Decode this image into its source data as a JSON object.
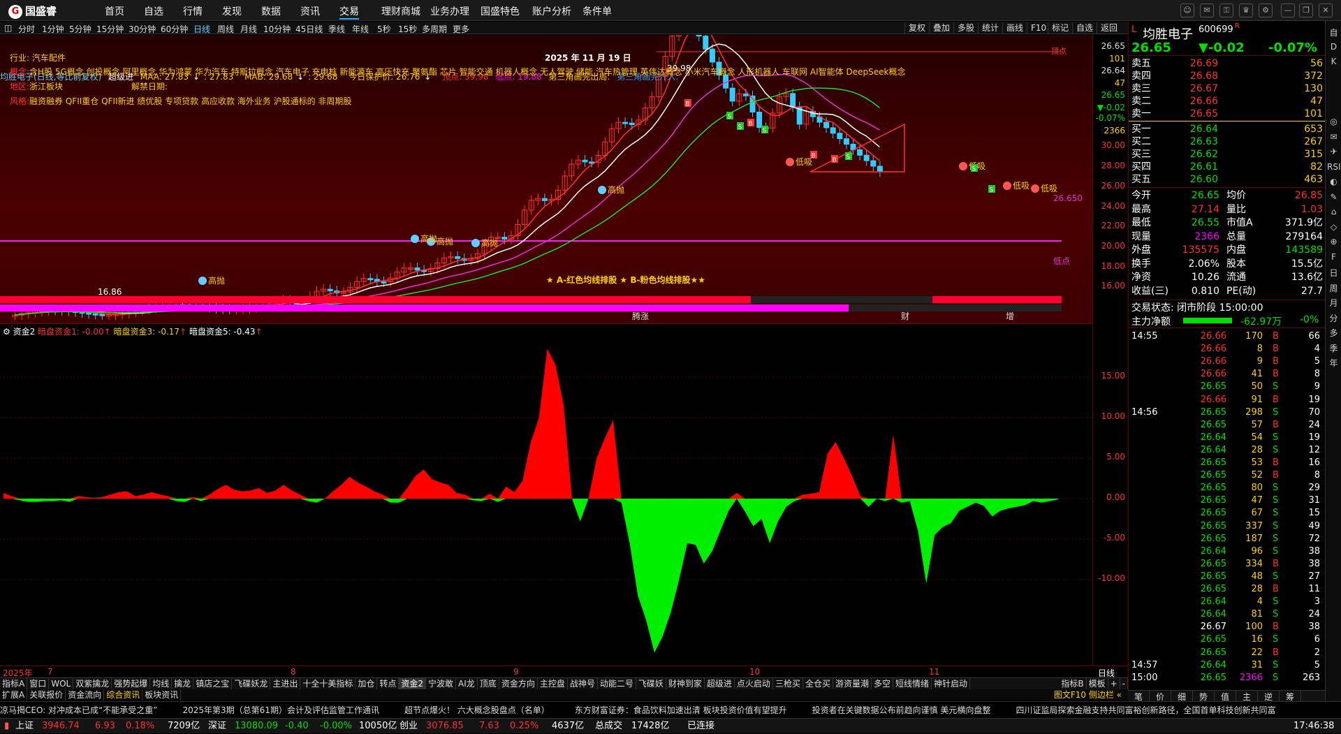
{
  "app": {
    "name": "国盛睿",
    "logo_glyph": "G"
  },
  "nav": [
    "首页",
    "自选",
    "行情",
    "发现",
    "数据",
    "资讯",
    "交易",
    "理财商城",
    "业务办理",
    "国盛特色",
    "账户分析",
    "条件单"
  ],
  "nav_active": 6,
  "period_bar": {
    "items": [
      "分时",
      "1分钟",
      "5分钟",
      "15分钟",
      "30分钟",
      "60分钟",
      "日线",
      "周线",
      "月线",
      "10分钟",
      "45日线",
      "季线",
      "年线",
      "5秒",
      "15秒",
      "多周期",
      "更多"
    ],
    "active": 6,
    "right": [
      "复权",
      "叠加",
      "多股",
      "统计",
      "画线",
      "F10",
      "标记",
      "自选",
      "返回"
    ]
  },
  "info": {
    "stock": "均胜电子(日线,等比前复权)",
    "indicator": "超级进",
    "maa": "MAA: 27.83",
    "maa_arrow": "↓",
    "maa2": ": 27.83",
    "mab": "MAB: 29.68",
    "mab_arrow": "↓",
    "mab2": ": 29.68",
    "guard": "今日保护价: 26.76",
    "guard_arrow": "↓",
    "top": "顶点: 39.98",
    "bottom": "低点: 19.88",
    "tri1": "第三角画完出局:",
    "tri2": "第三角画完介入:"
  },
  "overlay": {
    "industry": "行业: 汽车配件",
    "date": "2025 年 11 月 19 日",
    "concept_label": "概念:",
    "concepts": "含H股 5G概念 创投概念 阿里概念 华为鸿蒙 华为汽车 特斯拉概念 汽车电子 充电桩 新能源车 高压快充 聚氨酯 芯片 智能交通 机器人概念 无人驾驶 储能 汽车热管理 英伟达概念 小米汽车概念 人形机器人 车联网 AI智能体 DeepSeek概念",
    "region_label": "地区:",
    "region": "浙江板块",
    "ban_label": "解禁日期:",
    "style_label": "风格:",
    "style": "融资融券 QFII重仓 QFII新进 绩优股 专项贷款 高应收款 海外业务 沪股通标的 非周期股",
    "legend": "★ A-红色均线排股 ★ B-粉色均线排股★★",
    "peak": "39.98",
    "low_label": "低点",
    "low_val": "16.86",
    "last_val": "26.650",
    "tags": [
      "高抛",
      "高抛",
      "高抛",
      "高抛",
      "高抛",
      "低吸",
      "低吸",
      "低吸",
      "低吸",
      "低吸"
    ],
    "top_label": "顶点",
    "strip_labels": [
      "腾涨",
      "财",
      "增"
    ]
  },
  "k_axis": [
    "26.65",
    "101",
    "26.64",
    "47",
    "26.65",
    "▼-0.02",
    "-0.07%",
    "2366",
    "30.00",
    "28.00",
    "26.00",
    "24.00",
    "22.00",
    "20.00",
    "18.00",
    "16.00"
  ],
  "lower": {
    "title": "资金2",
    "s1": "暗盘资金1: -0.00",
    "s1a": "↑",
    "s3": "暗盘资金3: -0.17",
    "s3a": "↑",
    "s5": "暗盘资金5: -0.43",
    "s5a": "↑",
    "axis": [
      "15.00",
      "10.00",
      "5.00",
      "0.00",
      "-5.00",
      "-10.00"
    ]
  },
  "chart_data": {
    "type": "area",
    "title": "资金2",
    "ylim": [
      -19,
      19
    ],
    "series": [
      {
        "name": "暗盘资金",
        "values": [
          0.7,
          0.3,
          -0.2,
          -0.4,
          -0.4,
          -0.3,
          -0.3,
          -0.2,
          -0.4,
          0.3,
          0.2,
          0.1,
          0.2,
          0.5,
          0.8,
          0.9,
          0.3,
          0.5,
          0.8,
          0.5,
          0.3,
          -0.3,
          -0.4,
          0.2,
          -0.3,
          0.5,
          1.2,
          1.7,
          1.1,
          0.9,
          1.0,
          1.3,
          0.7,
          1.0,
          1.7,
          1.0,
          0.5,
          -0.3,
          -0.5,
          0.0,
          0.9,
          1.7,
          2.7,
          2.0,
          1.5,
          0.9,
          0.5,
          -0.5,
          -0.5,
          1.3,
          2.8,
          3.6,
          2.4,
          2.0,
          1.7,
          0.7,
          0.5,
          -0.2,
          -0.3,
          0.6,
          -0.4,
          1.5,
          0.8,
          2.2,
          7.0,
          10.0,
          18.5,
          16.5,
          11.5,
          0.0,
          -2.8,
          0.0,
          5.0,
          7.5,
          9.7,
          -0.5,
          -5.5,
          -12.0,
          -15.0,
          -19.0,
          -17.0,
          -14.0,
          -10.0,
          -5.5,
          -5.7,
          -8.0,
          -6.5,
          -4.0,
          -1.5,
          0.7,
          -1.6,
          -3.4,
          -2.5,
          -5.5,
          -2.8,
          -1.0,
          -0.3,
          0.5,
          0.6,
          0.8,
          5.5,
          7.0,
          5.0,
          2.8,
          0.3,
          -1.0,
          0.0,
          -0.3,
          7.9,
          -0.5,
          -0.3,
          -4.0,
          -10.5,
          -4.5,
          -3.5,
          -3.0,
          -1.5,
          -1.0,
          -0.5,
          -0.9,
          -2.2,
          -1.5,
          -1.2,
          -1.0,
          -0.8,
          -0.3,
          -0.5,
          -0.3,
          -0.1
        ]
      }
    ]
  },
  "dates": {
    "year": "2025年",
    "months": [
      "7",
      "8",
      "9",
      "10",
      "11"
    ],
    "right": "日线"
  },
  "tools1": [
    "指标A",
    "窗口",
    "WOL",
    "双紫擒龙",
    "强势起爆",
    "均线",
    "擒龙",
    "镇店之宝",
    "飞碟妖龙",
    "主进出",
    "十全十美指标",
    "加仓",
    "转点",
    "资金2",
    "宁波敢",
    "AI龙",
    "顶底",
    "资金方向",
    "主控盘",
    "战神号",
    "动能二号",
    "飞碟妖",
    "财神到家",
    "超级进",
    "点火启动",
    "三枪买",
    "全仓买",
    "游资量潮",
    "多空",
    "短线情绪",
    "神针启动"
  ],
  "tools1_right": [
    "指标B",
    "模板",
    "+",
    "-"
  ],
  "tools2": [
    "扩展A",
    "关联报价",
    "资金流向",
    "综合资讯",
    "板块资讯"
  ],
  "tools2_right": "图文F10 侧边栏 «",
  "news": [
    "凉马揭CEO: 对冲成本已成“不能承受之重”",
    "2025年第3期（总第61期）会计及评估监管工作通讯",
    "超节点爆火！ 六大概念股盘点（名单）",
    "东方财富证券：食品饮料加速出清 板块投资价值有望提升",
    "投资者在关键数据公布前趋向谨慎 美元横向盘整",
    "四川证监局探索金融支持共同富裕创新路径，全国首单科技创新共同富"
  ],
  "status": {
    "sh_label": "上证",
    "sh": "3946.74",
    "sh_ch": "6.93",
    "sh_pct": "0.18%",
    "sh_amt": "7209亿",
    "sz_label": "深证",
    "sz": "13080.09",
    "sz_ch": "-0.40",
    "sz_pct": "-0.00%",
    "sz_amt": "10050亿",
    "cy_label": "创业",
    "cy": "3076.85",
    "cy_ch": "7.63",
    "cy_pct": "0.25%",
    "cy_amt": "4637亿",
    "total_label": "总成交",
    "total": "17428亿",
    "conn": "已连接",
    "time": "17:46:38"
  },
  "quote": {
    "name": "均胜电子",
    "code": "600699",
    "flag": "L",
    "rz": "R",
    "price": "26.65",
    "change": "▼-0.02",
    "pct": "-0.07%",
    "asks": [
      [
        "卖五",
        "26.69",
        "56"
      ],
      [
        "卖四",
        "26.68",
        "372"
      ],
      [
        "卖三",
        "26.67",
        "130"
      ],
      [
        "卖二",
        "26.66",
        "47"
      ],
      [
        "卖一",
        "26.65",
        "101"
      ]
    ],
    "bids": [
      [
        "买一",
        "26.64",
        "653"
      ],
      [
        "买二",
        "26.63",
        "267"
      ],
      [
        "买三",
        "26.62",
        "315"
      ],
      [
        "买四",
        "26.61",
        "82"
      ],
      [
        "买五",
        "26.60",
        "463"
      ]
    ],
    "stats": [
      [
        "今开",
        "26.65",
        "均价",
        "26.85"
      ],
      [
        "最高",
        "27.14",
        "量比",
        "1.03"
      ],
      [
        "最低",
        "26.55",
        "市值A",
        "371.9亿"
      ],
      [
        "现量",
        "2366",
        "总量",
        "279164"
      ],
      [
        "外盘",
        "135575",
        "内盘",
        "143589"
      ],
      [
        "换手",
        "2.06%",
        "股本",
        "15.5亿"
      ],
      [
        "净资",
        "10.26",
        "流通",
        "13.6亿"
      ],
      [
        "收益(三)",
        "0.810",
        "PE(动)",
        "27.7"
      ]
    ],
    "state": "交易状态: 闭市阶段 15:00:00",
    "flow_label": "主力净额",
    "flow": "-62.97万",
    "flow_pct": "-0%"
  },
  "ticks": [
    [
      "14:55",
      "26.66",
      "170",
      "B",
      "66"
    ],
    [
      "",
      "26.66",
      "8",
      "B",
      "4"
    ],
    [
      "",
      "26.66",
      "9",
      "B",
      "5"
    ],
    [
      "",
      "26.66",
      "41",
      "B",
      "8"
    ],
    [
      "",
      "26.65",
      "50",
      "S",
      "9"
    ],
    [
      "",
      "26.66",
      "91",
      "B",
      "19"
    ],
    [
      "14:56",
      "26.65",
      "298",
      "S",
      "70"
    ],
    [
      "",
      "26.65",
      "57",
      "B",
      "24"
    ],
    [
      "",
      "26.64",
      "54",
      "S",
      "19"
    ],
    [
      "",
      "26.64",
      "28",
      "S",
      "12"
    ],
    [
      "",
      "26.65",
      "53",
      "B",
      "16"
    ],
    [
      "",
      "26.65",
      "52",
      "B",
      "8"
    ],
    [
      "",
      "26.65",
      "80",
      "S",
      "29"
    ],
    [
      "",
      "26.65",
      "47",
      "S",
      "31"
    ],
    [
      "",
      "26.65",
      "67",
      "S",
      "15"
    ],
    [
      "",
      "26.65",
      "337",
      "S",
      "49"
    ],
    [
      "",
      "26.65",
      "187",
      "S",
      "72"
    ],
    [
      "",
      "26.64",
      "96",
      "S",
      "38"
    ],
    [
      "",
      "26.65",
      "334",
      "B",
      "38"
    ],
    [
      "",
      "26.65",
      "48",
      "S",
      "27"
    ],
    [
      "",
      "26.65",
      "28",
      "B",
      "11"
    ],
    [
      "",
      "26.64",
      "4",
      "S",
      "3"
    ],
    [
      "",
      "26.64",
      "81",
      "S",
      "24"
    ],
    [
      "",
      "26.67",
      "100",
      "B",
      "38"
    ],
    [
      "",
      "26.65",
      "16",
      "S",
      "6"
    ],
    [
      "",
      "26.65",
      "22",
      "B",
      "2"
    ],
    [
      "14:57",
      "26.64",
      "31",
      "S",
      "5"
    ],
    [
      "15:00",
      "26.65",
      "2366",
      "S",
      "263"
    ]
  ],
  "rbottom": [
    "笔",
    "价",
    "细",
    "势",
    "值",
    "主",
    "逆",
    "筹"
  ],
  "rtool": [
    "自",
    "D",
    "K",
    "",
    "",
    " ",
    "◎",
    "✉",
    "✈",
    "RSI",
    "◐",
    "✎",
    "⌂",
    "◇",
    "⊕",
    "F",
    "日",
    "周",
    "月",
    "分",
    "多",
    "季",
    "年"
  ]
}
